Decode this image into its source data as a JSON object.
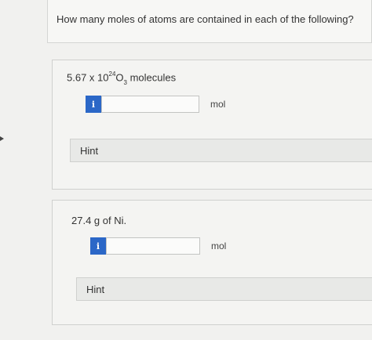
{
  "question": "How many moles of atoms are contained in each of the following?",
  "parts": [
    {
      "prompt": {
        "coef": "5.67 x 10",
        "exp": "24",
        "formula": "O",
        "sub": "3",
        "rest": " molecules"
      },
      "info_label": "i",
      "answer_value": "",
      "unit": "mol",
      "hint": "Hint"
    },
    {
      "prompt": {
        "text": "27.4 g of Ni."
      },
      "info_label": "i",
      "answer_value": "",
      "unit": "mol",
      "hint": "Hint"
    }
  ],
  "colors": {
    "info_button": "#2b67c7",
    "background": "#f1f1ef"
  }
}
